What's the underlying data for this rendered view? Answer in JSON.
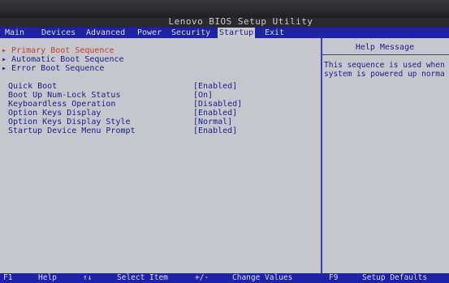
{
  "title": "Lenovo BIOS Setup Utility",
  "menu": {
    "tabs": [
      {
        "label": "Main"
      },
      {
        "label": "Devices"
      },
      {
        "label": "Advanced"
      },
      {
        "label": "Power"
      },
      {
        "label": "Security"
      },
      {
        "label": "Startup"
      },
      {
        "label": "Exit"
      }
    ]
  },
  "submenus": [
    {
      "label": "Primary Boot Sequence",
      "selected": true
    },
    {
      "label": "Automatic Boot Sequence",
      "selected": false
    },
    {
      "label": "Error Boot Sequence",
      "selected": false
    }
  ],
  "settings": [
    {
      "label": "Quick Boot",
      "value": "[Enabled]"
    },
    {
      "label": "Boot Up Num-Lock Status",
      "value": "[On]"
    },
    {
      "label": "Keyboardless Operation",
      "value": "[Disabled]"
    },
    {
      "label": "Option Keys Display",
      "value": "[Enabled]"
    },
    {
      "label": "Option Keys Display Style",
      "value": "[Normal]"
    },
    {
      "label": "Startup Device Menu Prompt",
      "value": "[Enabled]"
    }
  ],
  "help": {
    "title": "Help Message",
    "text": "This sequence is used when\nsystem is powered up norma"
  },
  "footer": {
    "f1": "F1",
    "help": "Help",
    "arrows": "↑↓",
    "select_item": "Select Item",
    "plusminus": "+/-",
    "change_values": "Change Values",
    "f9": "F9",
    "setup_defaults": "Setup Defaults"
  }
}
